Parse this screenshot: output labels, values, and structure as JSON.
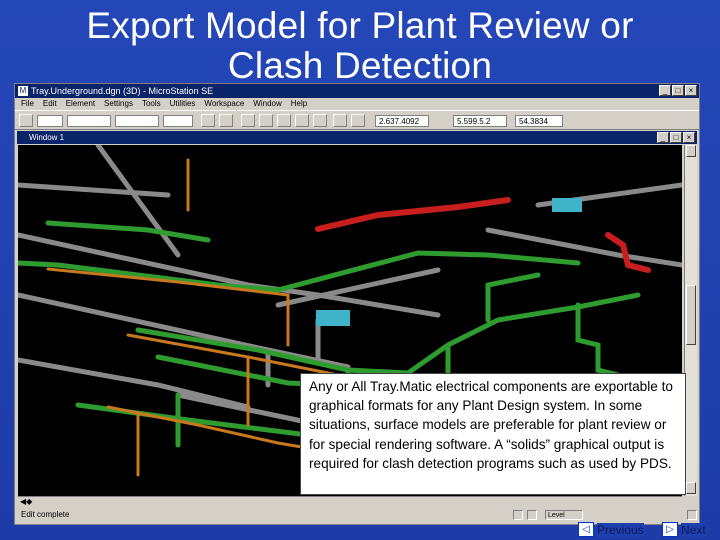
{
  "slide": {
    "title": "Export Model for Plant Review or Clash Detection"
  },
  "app": {
    "window_title": "Tray.Underground.dgn (3D) - MicroStation SE",
    "menu": [
      "File",
      "Edit",
      "Element",
      "Settings",
      "Tools",
      "Utilities",
      "Workspace",
      "Window",
      "Help"
    ],
    "toolbar_fields": [
      "2.637.4092",
      "5.599.5.2",
      "54.3834"
    ],
    "view_title": "Window 1",
    "status_left": "Edit complete",
    "status_fields": [
      "Level"
    ]
  },
  "callout": {
    "text": "Any or All Tray.Matic electrical components are exportable to graphical formats for any Plant Design system. In some situations, surface models are preferable for plant review or for special rendering software. A “solids” graphical output is required for clash detection programs such as used by PDS."
  },
  "nav": {
    "previous_label": "Previous",
    "next_label": "Next",
    "previous_icon": "left-arrow-icon",
    "next_icon": "right-arrow-icon"
  },
  "colors": {
    "slide_bg": "#1e3fae",
    "tray_green": "#3fbf3f",
    "tray_red": "#c81e1e",
    "tray_orange": "#c8781e",
    "tray_gray": "#8c8c8c",
    "junction_cyan": "#3fb4c8"
  }
}
